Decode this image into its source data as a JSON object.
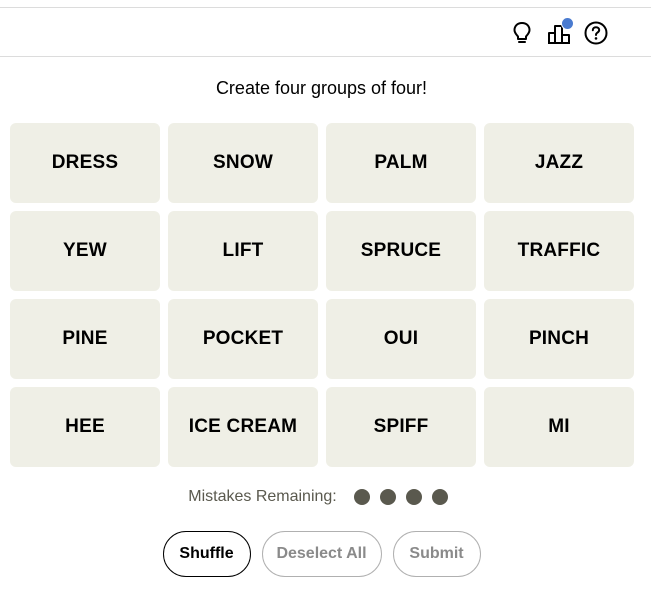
{
  "toolbar": {
    "icons": [
      "lightbulb-icon",
      "leaderboard-icon",
      "help-icon"
    ],
    "notification_color": "#4a7bd0"
  },
  "game": {
    "instructions": "Create four groups of four!",
    "tiles": [
      "DRESS",
      "SNOW",
      "PALM",
      "JAZZ",
      "YEW",
      "LIFT",
      "SPRUCE",
      "TRAFFIC",
      "PINE",
      "POCKET",
      "OUI",
      "PINCH",
      "HEE",
      "ICE CREAM",
      "SPIFF",
      "MI"
    ],
    "tile_color": "#efefe6",
    "mistakes_label": "Mistakes Remaining:",
    "mistakes_remaining": 4,
    "dot_color": "#5a594e"
  },
  "controls": {
    "shuffle_label": "Shuffle",
    "deselect_label": "Deselect All",
    "submit_label": "Submit"
  }
}
